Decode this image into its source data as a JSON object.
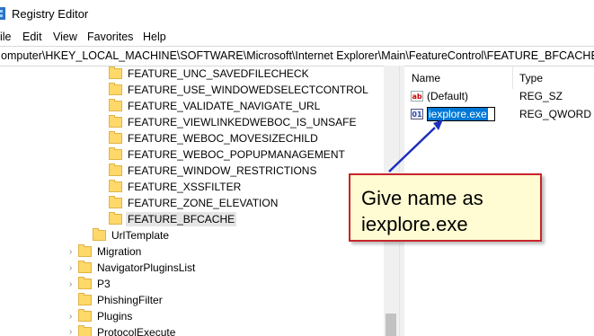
{
  "window": {
    "title": "Registry Editor"
  },
  "menu": {
    "file": "ile",
    "edit": "Edit",
    "view": "View",
    "favorites": "Favorites",
    "help": "Help"
  },
  "address": "omputer\\HKEY_LOCAL_MACHINE\\SOFTWARE\\Microsoft\\Internet Explorer\\Main\\FeatureControl\\FEATURE_BFCACHE",
  "tree": {
    "items": [
      {
        "label": "FEATURE_UNC_SAVEDFILECHECK"
      },
      {
        "label": "FEATURE_USE_WINDOWEDSELECTCONTROL"
      },
      {
        "label": "FEATURE_VALIDATE_NAVIGATE_URL"
      },
      {
        "label": "FEATURE_VIEWLINKEDWEBOC_IS_UNSAFE"
      },
      {
        "label": "FEATURE_WEBOC_MOVESIZECHILD"
      },
      {
        "label": "FEATURE_WEBOC_POPUPMANAGEMENT"
      },
      {
        "label": "FEATURE_WINDOW_RESTRICTIONS"
      },
      {
        "label": "FEATURE_XSSFILTER"
      },
      {
        "label": "FEATURE_ZONE_ELEVATION"
      },
      {
        "label": "FEATURE_BFCACHE",
        "selected": true
      },
      {
        "label": "UrlTemplate"
      },
      {
        "label": "Migration"
      },
      {
        "label": "NavigatorPluginsList"
      },
      {
        "label": "P3"
      },
      {
        "label": "PhishingFilter"
      },
      {
        "label": "Plugins"
      },
      {
        "label": "ProtocolExecute"
      }
    ]
  },
  "values": {
    "headers": {
      "name": "Name",
      "type": "Type"
    },
    "rows": [
      {
        "icon": "string-value-icon",
        "name": "(Default)",
        "type": "REG_SZ"
      },
      {
        "icon": "binary-value-icon",
        "name": "iexplore.exe",
        "type": "REG_QWORD",
        "editing": true
      }
    ]
  },
  "callout": {
    "line1": "Give name as",
    "line2": "iexplore.exe"
  },
  "colors": {
    "selection": "#0078d7",
    "callout_border": "#c8242b",
    "callout_bg": "#fffbd2",
    "arrow": "#1e2fbe"
  }
}
